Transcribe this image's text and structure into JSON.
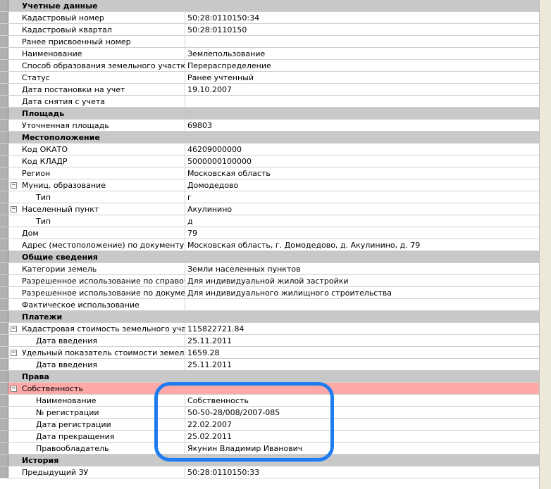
{
  "rows": [
    {
      "type": "category",
      "name": "Учетные данные"
    },
    {
      "type": "prop",
      "name": "Кадастровый номер",
      "value": "50:28:0110150:34"
    },
    {
      "type": "prop",
      "name": "Кадастровый квартал",
      "value": "50:28:0110150"
    },
    {
      "type": "prop",
      "name": "Ранее присвоенный номер",
      "value": ""
    },
    {
      "type": "prop",
      "name": "Наименование",
      "value": "Землепользование"
    },
    {
      "type": "prop",
      "name": "Способ образования земельного участка",
      "value": "Перераспределение"
    },
    {
      "type": "prop",
      "name": "Статус",
      "value": "Ранее учтенный"
    },
    {
      "type": "prop",
      "name": "Дата постановки на учет",
      "value": "19.10.2007"
    },
    {
      "type": "prop",
      "name": "Дата снятия с учета",
      "value": ""
    },
    {
      "type": "category",
      "name": "Площадь"
    },
    {
      "type": "prop",
      "name": "Уточненная площадь",
      "value": "69803"
    },
    {
      "type": "category",
      "name": "Местоположение"
    },
    {
      "type": "prop",
      "name": "Код ОКАТО",
      "value": "46209000000"
    },
    {
      "type": "prop",
      "name": "Код КЛАДР",
      "value": "5000000100000"
    },
    {
      "type": "prop",
      "name": "Регион",
      "value": "Московская область"
    },
    {
      "type": "group",
      "name": "Муниц. образование",
      "value": "Домодедово",
      "expander": "−"
    },
    {
      "type": "sub",
      "name": "Тип",
      "value": "г"
    },
    {
      "type": "group",
      "name": "Населенный пункт",
      "value": "Акулинино",
      "expander": "−"
    },
    {
      "type": "sub",
      "name": "Тип",
      "value": "д"
    },
    {
      "type": "prop",
      "name": "Дом",
      "value": "79"
    },
    {
      "type": "prop",
      "name": "Адрес (местоположение) по документу",
      "value": "Московская область, г. Домодедово, д. Акулинино, д. 79"
    },
    {
      "type": "category",
      "name": "Общие сведения"
    },
    {
      "type": "prop",
      "name": "Категории земель",
      "value": "Земли населенных пунктов"
    },
    {
      "type": "prop",
      "name": "Разрешенное использование по справочни",
      "value": "Для индивидуальной жилой застройки"
    },
    {
      "type": "prop",
      "name": "Разрешенное использование по документу",
      "value": "Для индивидуального жилищного строительства"
    },
    {
      "type": "prop",
      "name": "Фактическое использование",
      "value": ""
    },
    {
      "type": "category",
      "name": "Платежи"
    },
    {
      "type": "group",
      "name": "Кадастровая стоимость земельного участка",
      "value": "115822721.84",
      "expander": "−"
    },
    {
      "type": "sub",
      "name": "Дата введения",
      "value": "25.11.2011"
    },
    {
      "type": "group",
      "name": "Удельный показатель стоимости земель",
      "value": "1659.28",
      "expander": "−"
    },
    {
      "type": "sub",
      "name": "Дата введения",
      "value": "25.11.2011"
    },
    {
      "type": "category",
      "name": "Права"
    },
    {
      "type": "selected",
      "name": "Собственность",
      "value": "",
      "expander": "−"
    },
    {
      "type": "sub",
      "name": "Наименование",
      "value": "Собственность"
    },
    {
      "type": "sub",
      "name": "№ регистрации",
      "value": "50-50-28/008/2007-085"
    },
    {
      "type": "sub",
      "name": "Дата регистрации",
      "value": "22.02.2007"
    },
    {
      "type": "sub",
      "name": "Дата прекращения",
      "value": "25.02.2011"
    },
    {
      "type": "sub",
      "name": "Правообладатель",
      "value": "Якунин Владимир Иванович"
    },
    {
      "type": "category",
      "name": "История"
    },
    {
      "type": "prop",
      "name": "Предыдущий ЗУ",
      "value": "50:28:0110150:33"
    }
  ],
  "colors": {
    "highlight": "#1e7cf0",
    "selected_row": "#ffa8a8",
    "category_row": "#c8c8c8"
  }
}
